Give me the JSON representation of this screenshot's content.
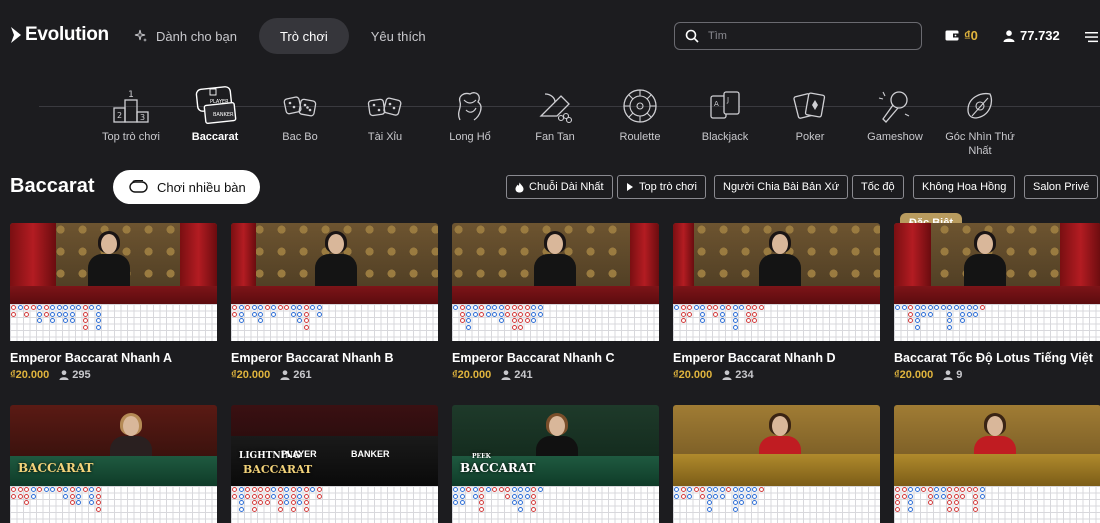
{
  "header": {
    "logo": "Evolution",
    "nav": [
      {
        "label": "Dành cho bạn",
        "icon": "sparkle-icon"
      },
      {
        "label": "Trò chơi",
        "active": true
      },
      {
        "label": "Yêu thích"
      }
    ],
    "search_placeholder": "Tìm",
    "wallet_value": "₫0",
    "players_count": "77.732"
  },
  "categories": [
    {
      "label": "Top trò chơi",
      "icon": "podium-icon"
    },
    {
      "label": "Baccarat",
      "icon": "baccarat-icon",
      "active": true
    },
    {
      "label": "Bac Bo",
      "icon": "dice-icon"
    },
    {
      "label": "Tài Xỉu",
      "icon": "dice-icon"
    },
    {
      "label": "Long Hổ",
      "icon": "dragon-tiger-icon"
    },
    {
      "label": "Fan Tan",
      "icon": "fan-tan-icon"
    },
    {
      "label": "Roulette",
      "icon": "roulette-icon"
    },
    {
      "label": "Blackjack",
      "icon": "cards-icon"
    },
    {
      "label": "Poker",
      "icon": "poker-cards-icon"
    },
    {
      "label": "Gameshow",
      "icon": "microphone-icon"
    },
    {
      "label": "Góc Nhìn Thứ Nhất",
      "icon": "first-person-icon"
    }
  ],
  "section": {
    "title": "Baccarat",
    "multi_play_label": "Chơi nhiều bàn",
    "filters": [
      {
        "label": "Chuỗi Dài Nhất",
        "icon": "flame-icon"
      },
      {
        "label": "Top trò chơi",
        "icon": "play-icon"
      },
      {
        "label": "Người Chia Bài Bản Xứ"
      },
      {
        "label": "Tốc độ"
      },
      {
        "label": "Không Hoa Hồng"
      },
      {
        "label": "Salon Privé"
      }
    ]
  },
  "badge": "Đặc Biệt",
  "games": [
    {
      "title": "Emperor Baccarat Nhanh A",
      "min_bet": "₫20.000",
      "players": "295"
    },
    {
      "title": "Emperor Baccarat Nhanh B",
      "min_bet": "₫20.000",
      "players": "261"
    },
    {
      "title": "Emperor Baccarat Nhanh C",
      "min_bet": "₫20.000",
      "players": "241"
    },
    {
      "title": "Emperor Baccarat Nhanh D",
      "min_bet": "₫20.000",
      "players": "234"
    },
    {
      "title": "Baccarat Tốc Độ Lotus Tiếng Việt",
      "min_bet": "₫20.000",
      "players": "9"
    }
  ],
  "thumb_text": {
    "baccarat": "BACCARAT",
    "lightning": "LIGHTNING",
    "player": "PLAYER",
    "banker": "BANKER",
    "peek": "PEEK"
  },
  "colors": {
    "accent_gold": "#e0b43d",
    "background": "#1c1c1f",
    "banker": "#d23c3c",
    "player": "#2f6fd6"
  }
}
